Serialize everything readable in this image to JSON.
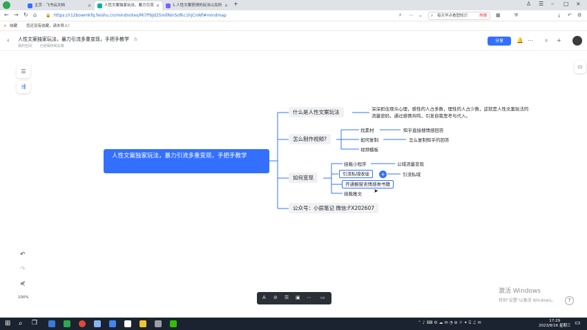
{
  "browser": {
    "tabs": [
      {
        "label": "主页 - 飞书云文档",
        "active": false
      },
      {
        "label": "人性文案独家玩法，暴力引流",
        "active": true
      },
      {
        "label": "1.人性文案获得的玩法以及所",
        "active": false
      }
    ],
    "new_tab": "+",
    "url": "https://r12bowmkfq.feishu.cn/mindnotes/Mi7PbJd2SmllNinSofkc1hjCnWf#mindmap",
    "search_placeholder": "每天学点看图知识",
    "hot_label": "热搜",
    "bookmarks": {
      "star_label": "收藏",
      "import_text": "您还没有收藏，请去导入！"
    }
  },
  "app": {
    "title": "人性文案独家玩法，暴力引流多重变现，手把手教学",
    "breadcrumb": "我的空间",
    "save_status": "已经保存到云端",
    "share_label": "分享"
  },
  "mindmap": {
    "root": "人性文案独家玩法，暴力引流多重变现，手把手教学",
    "branches": [
      {
        "label": "什么是人性文案玩法",
        "description": "深深抓住观众心理，感性的人占多数，理性的人占少数，这就是人性文案玩法的流量密码，通过感情共鸣，引发自我思考与代入。"
      },
      {
        "label": "怎么制作视频?",
        "children": [
          {
            "label": "找素材",
            "leaf": "知乎直接搜情感回答"
          },
          {
            "label": "如何复制",
            "leaf": "怎么复制知乎的回答"
          },
          {
            "label": "视频模板",
            "leaf": ""
          }
        ]
      },
      {
        "label": "如何变现",
        "children": [
          {
            "label": "挂载小程序",
            "leaf": "公域流量变现"
          },
          {
            "label": "引流私域收徒",
            "leaf": "引流私域"
          },
          {
            "label": "开通橱窗卖情感类书籍",
            "leaf": ""
          },
          {
            "label": "挂载推文",
            "leaf": ""
          }
        ]
      },
      {
        "label": "公众号：小辰笔记  微信:FX202607"
      }
    ]
  },
  "zoom": "100%",
  "watermark": {
    "title": "激活 Windows",
    "subtitle": "转到\"设置\"以激活 Windows。"
  },
  "taskbar": {
    "time": "17:29",
    "date": "2023/8/16 星期三"
  },
  "colors": {
    "accent": "#3370ff",
    "node_bg": "#f0f1f3",
    "line": "#3370ff"
  }
}
